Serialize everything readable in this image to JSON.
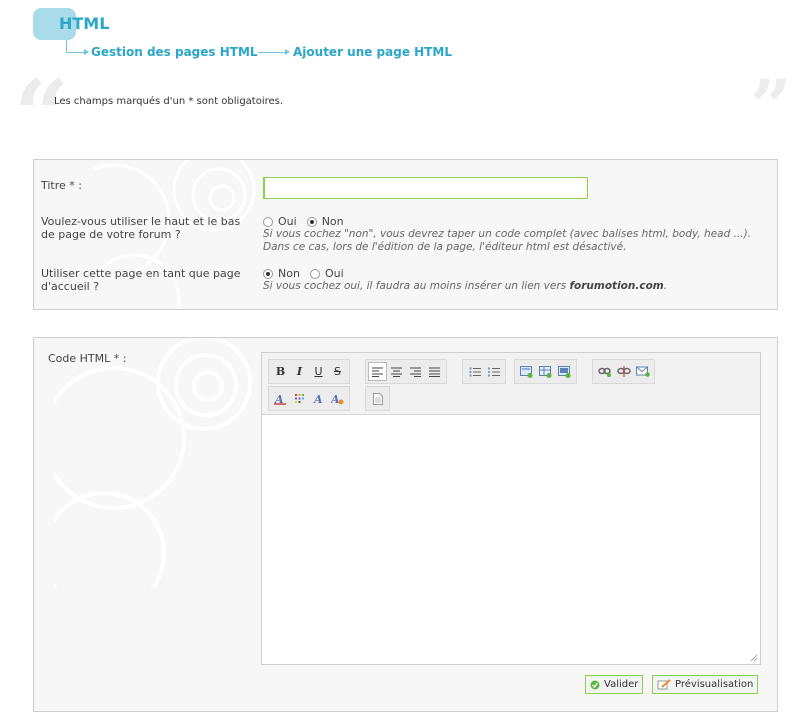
{
  "header": {
    "title": "HTML"
  },
  "breadcrumb": {
    "item1": "Gestion des pages HTML",
    "item2": "Ajouter une page HTML"
  },
  "notice": "Les champs marqués d'un * sont obligatoires.",
  "form1": {
    "title_label": "Titre * :",
    "title_value": "",
    "header_footer": {
      "label": "Voulez-vous utiliser le haut et le bas de page de votre forum ?",
      "options": [
        "Oui",
        "Non"
      ],
      "selected": "Non",
      "help_line1": "Si vous cochez \"non\", vous devrez taper un code complet (avec balises html, body, head ...).",
      "help_line2": "Dans ce cas, lors de l'édition de la page, l'éditeur html est désactivé."
    },
    "homepage": {
      "label": "Utiliser cette page en tant que page d'accueil ?",
      "options": [
        "Non",
        "Oui"
      ],
      "selected": "Non",
      "help_prefix": "Si vous cochez oui, il faudra au moins insérer un lien vers ",
      "help_bold": "forumotion.com",
      "help_suffix": "."
    }
  },
  "form2": {
    "code_label": "Code HTML * :",
    "code_value": "",
    "toolbar": {
      "bold": "B",
      "italic": "I",
      "underline": "U",
      "strike": "S"
    }
  },
  "buttons": {
    "validate": "Valider",
    "preview": "Prévisualisation"
  },
  "colors": {
    "accent": "#2aa6c9",
    "header_pill": "#a9dbeb",
    "input_border": "#8bd14d",
    "panel_bg": "#f7f7f7"
  }
}
